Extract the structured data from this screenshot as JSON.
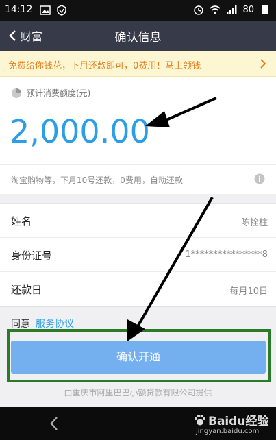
{
  "status_bar": {
    "time": "14:12",
    "battery": "80"
  },
  "nav": {
    "back_label": "财富",
    "title": "确认信息"
  },
  "banner": {
    "text": "免费给你钱花，下月还款即可，0费用！马上领钱"
  },
  "amount": {
    "label": "预计消费额度(元)",
    "value": "2,000.00",
    "note": "淘宝购物等，下月10号还款，0费用，自动还款"
  },
  "info": [
    {
      "key": "姓名",
      "value": "陈拴柱"
    },
    {
      "key": "身份证号",
      "value": "1****************8"
    },
    {
      "key": "还款日",
      "value": "每月10日"
    }
  ],
  "agreement": {
    "prefix": "同意",
    "link": "服务协议"
  },
  "confirm_button": {
    "label": "确认开通"
  },
  "provider": "由重庆市阿里巴巴小额贷款有限公司提供",
  "watermark": {
    "name": "Baidu经验",
    "url": "jingyan.baidu.com"
  },
  "colors": {
    "accent": "#2b9ee6",
    "button": "#74aff0",
    "nav": "#373b49",
    "banner_text": "#e67e1c",
    "frame": "#2a7a2a"
  }
}
